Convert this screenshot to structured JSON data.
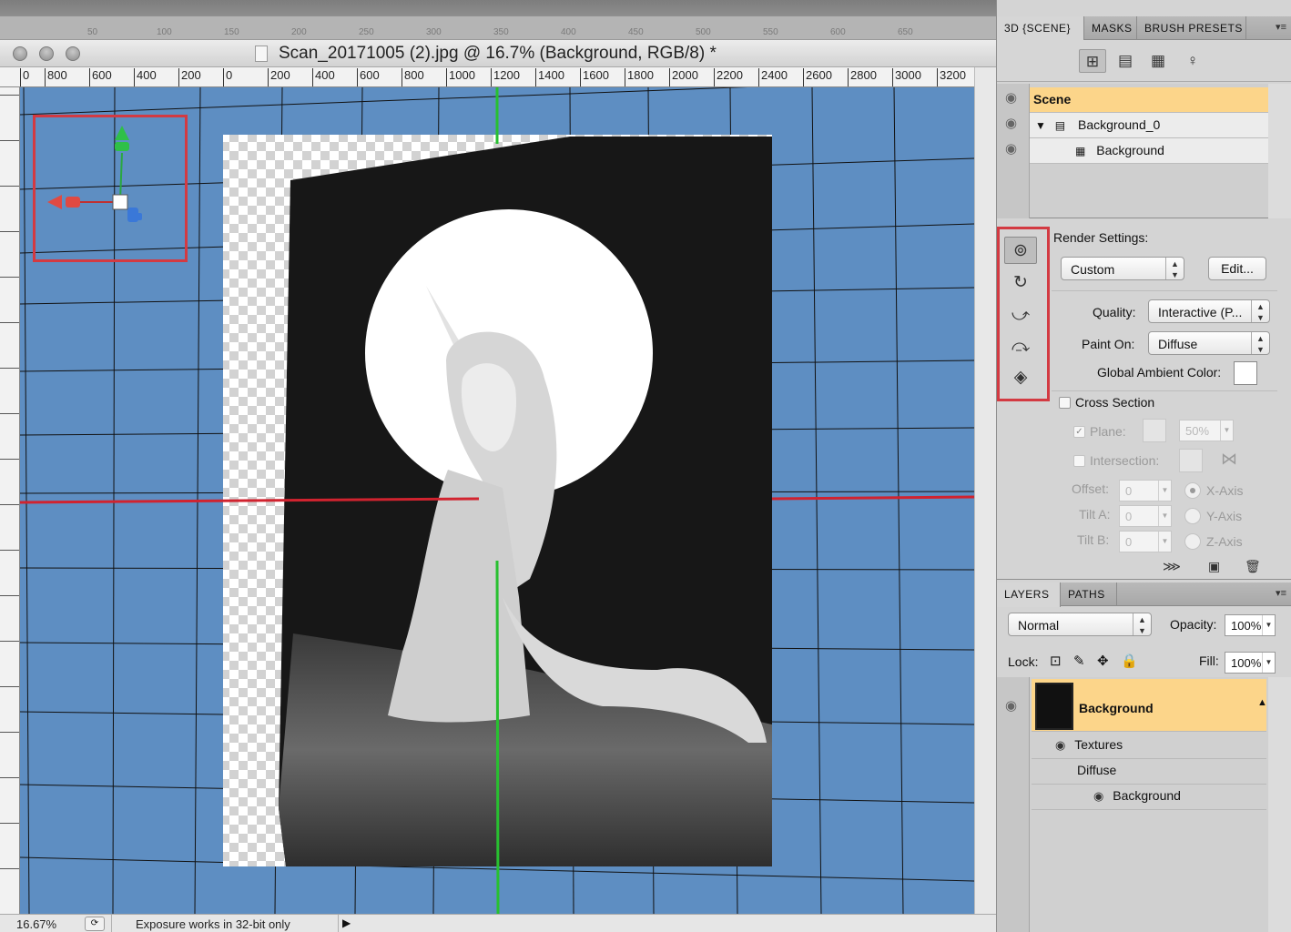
{
  "document": {
    "title": "Scan_20171005 (2).jpg @ 16.7% (Background, RGB/8) *",
    "ruler_h_labels": [
      "0",
      "800",
      "600",
      "400",
      "200",
      "0",
      "200",
      "400",
      "600",
      "800",
      "1000",
      "1200",
      "1400",
      "1600",
      "1800",
      "2000",
      "2200",
      "2400",
      "2600",
      "2800",
      "3000",
      "3200"
    ],
    "bg_ruler_labels": [
      "50",
      "100",
      "150",
      "200",
      "250",
      "300",
      "350",
      "400",
      "450",
      "500",
      "550",
      "600",
      "650"
    ]
  },
  "status": {
    "zoom": "16.67%",
    "message": "Exposure works in 32-bit only"
  },
  "scene_panel": {
    "tabs": [
      "3D {SCENE}",
      "MASKS",
      "BRUSH PRESETS"
    ],
    "toolbar_icons": [
      "scene-icon",
      "mesh-icon",
      "material-icon",
      "light-icon"
    ],
    "items": [
      {
        "label": "Scene"
      },
      {
        "label": "Background_0"
      },
      {
        "label": "Background"
      }
    ]
  },
  "render": {
    "settings_label": "Render Settings:",
    "preset": "Custom",
    "edit_label": "Edit...",
    "quality_label": "Quality:",
    "quality_value": "Interactive (P...",
    "paint_on_label": "Paint On:",
    "paint_on_value": "Diffuse",
    "ambient_label": "Global Ambient Color:",
    "ambient_color": "#ffffff",
    "cross_section_label": "Cross Section",
    "plane_label": "Plane:",
    "plane_opacity": "50%",
    "intersection_label": "Intersection:",
    "offset_label": "Offset:",
    "offset_value": "0",
    "tilt_a_label": "Tilt A:",
    "tilt_a_value": "0",
    "tilt_b_label": "Tilt B:",
    "tilt_b_value": "0",
    "x_axis": "X-Axis",
    "y_axis": "Y-Axis",
    "z_axis": "Z-Axis"
  },
  "layers_panel": {
    "tabs": [
      "LAYERS",
      "PATHS"
    ],
    "blend_mode": "Normal",
    "opacity_label": "Opacity:",
    "opacity_value": "100%",
    "lock_label": "Lock:",
    "fill_label": "Fill:",
    "fill_value": "100%",
    "layer_name": "Background",
    "sub_items": [
      "Textures",
      "Diffuse",
      "Background"
    ]
  },
  "colors": {
    "canvas_bg": "#5e8ec2",
    "selection": "#fcd58a",
    "highlight_box": "#d33a42"
  }
}
